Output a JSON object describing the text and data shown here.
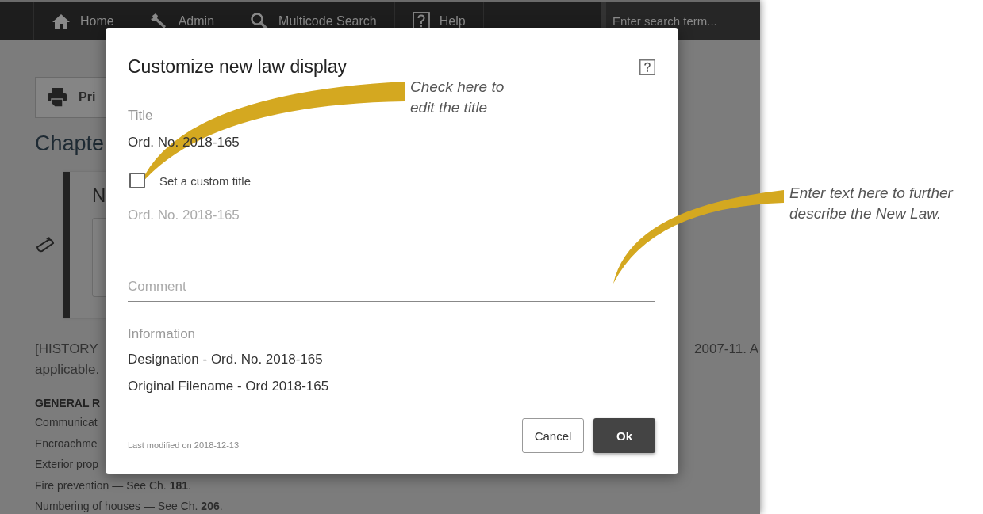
{
  "nav": {
    "items": [
      {
        "label": "Home"
      },
      {
        "label": "Admin"
      },
      {
        "label": "Multicode Search"
      },
      {
        "label": "Help"
      }
    ],
    "search": {
      "placeholder": "Enter search term..."
    }
  },
  "page": {
    "print_button": "Pri",
    "heading": "Chapte",
    "panel_title": "N",
    "history_left": "[HISTORY",
    "history_right": "2007-11. A",
    "history_line2": "applicable.",
    "section_heading": "GENERAL R",
    "entries": [
      "Communicat",
      "Encroachme",
      "Exterior prop",
      "Fire prevention — See Ch. **181**.",
      "Numbering of houses — See Ch. **206**."
    ]
  },
  "dialog": {
    "title": "Customize new law display",
    "title_label": "Title",
    "current_title": "Ord. No. 2018-165",
    "custom_title": {
      "label": "Set a custom title",
      "checked": false
    },
    "title_field": {
      "placeholder": "Ord. No. 2018-165",
      "disabled": true
    },
    "comment_field": {
      "placeholder": "Comment",
      "disabled": false
    },
    "information_label": "Information",
    "information": [
      "Designation - Ord. No. 2018-165",
      "Original Filename - Ord 2018-165"
    ],
    "last_modified": "Last modified on 2018-12-13",
    "buttons": [
      {
        "label": "Cancel",
        "kind": "secondary"
      },
      {
        "label": "Ok",
        "kind": "primary"
      }
    ]
  },
  "callouts": [
    {
      "text": "Check here to edit the title"
    },
    {
      "text": "Enter text here to further describe the New Law."
    }
  ]
}
